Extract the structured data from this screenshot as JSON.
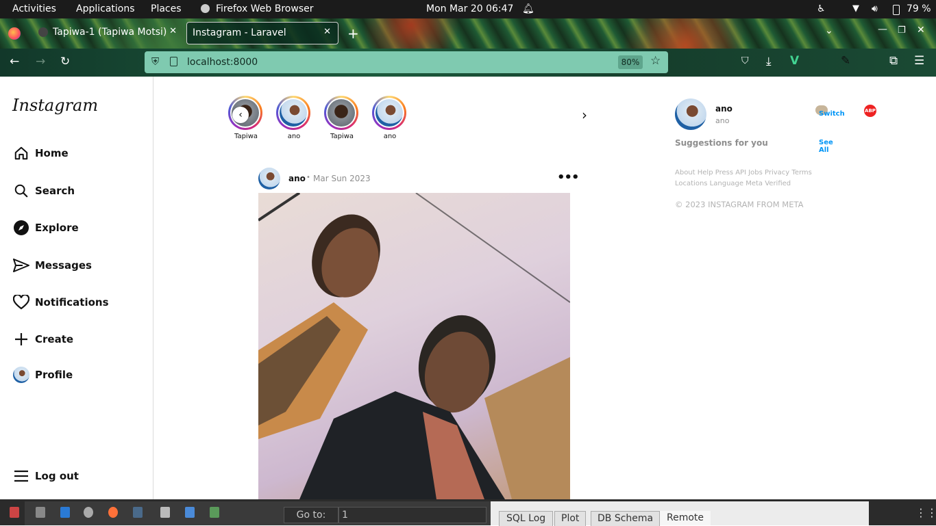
{
  "system_bar": {
    "activities": "Activities",
    "applications": "Applications",
    "places": "Places",
    "app_name": "Firefox Web Browser",
    "clock": "Mon Mar 20  06:47",
    "battery": "79 %"
  },
  "browser": {
    "tabs": [
      {
        "label": "Tapiwa-1 (Tapiwa Motsi)",
        "active": false
      },
      {
        "label": "Instagram - Laravel",
        "active": true
      }
    ],
    "url": "localhost:8000",
    "zoom": "80%"
  },
  "instagram": {
    "logo": "Instagram",
    "nav": [
      {
        "label": "Home",
        "icon": "home-icon"
      },
      {
        "label": "Search",
        "icon": "search-icon"
      },
      {
        "label": "Explore",
        "icon": "compass-icon"
      },
      {
        "label": "Messages",
        "icon": "send-icon"
      },
      {
        "label": "Notifications",
        "icon": "heart-icon"
      },
      {
        "label": "Create",
        "icon": "plus-icon"
      },
      {
        "label": "Profile",
        "icon": "avatar"
      }
    ],
    "logout": "Log out",
    "stories": [
      {
        "name": "Tapiwa"
      },
      {
        "name": "ano"
      },
      {
        "name": "Tapiwa"
      },
      {
        "name": "ano"
      }
    ],
    "post": {
      "username": "ano",
      "separator": "•",
      "date": "Mar Sun 2023"
    },
    "right": {
      "username": "ano",
      "subname": "ano",
      "switch": "Switch",
      "suggestions": "Suggestions for you",
      "see_all": "See All",
      "footer_line1": "About Help Press API Jobs Privacy Terms",
      "footer_line2": "Locations Language Meta Verified",
      "copyright": "© 2023 INSTAGRAM FROM META"
    }
  },
  "background_app": {
    "goto_label": "Go to:",
    "goto_value": "1",
    "tabs": [
      "SQL Log",
      "Plot",
      "DB Schema",
      "Remote"
    ]
  },
  "colors": {
    "instagram_link": "#0095f6",
    "url_bar": "#7fcab0",
    "top_bar": "#1b1b1b"
  }
}
